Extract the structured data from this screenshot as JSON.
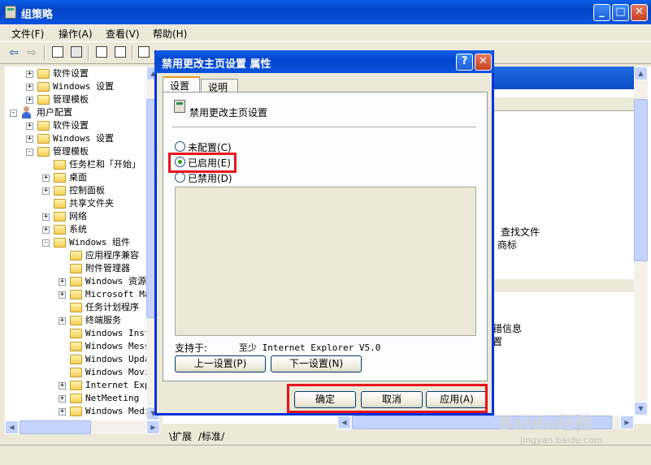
{
  "main_window": {
    "title": "组策略",
    "menu": [
      "文件(F)",
      "操作(A)",
      "查看(V)",
      "帮助(H)"
    ]
  },
  "tree": {
    "items": [
      {
        "label": "软件设置",
        "expander": "+"
      },
      {
        "label": "Windows 设置",
        "expander": "+"
      },
      {
        "label": "管理模板",
        "expander": "+"
      },
      {
        "label": "用户配置",
        "expander": "-"
      },
      {
        "label": "软件设置",
        "expander": "+"
      },
      {
        "label": "Windows 设置",
        "expander": "+"
      },
      {
        "label": "管理模板",
        "expander": "-"
      },
      {
        "label": "任务栏和「开始」",
        "expander": ""
      },
      {
        "label": "桌面",
        "expander": "+"
      },
      {
        "label": "控制面板",
        "expander": "+"
      },
      {
        "label": "共享文件夹",
        "expander": ""
      },
      {
        "label": "网络",
        "expander": "+"
      },
      {
        "label": "系统",
        "expander": "+"
      },
      {
        "label": "Windows 组件",
        "expander": "-"
      },
      {
        "label": "应用程序兼容",
        "expander": ""
      },
      {
        "label": "附件管理器",
        "expander": ""
      },
      {
        "label": "Windows 资源",
        "expander": "+"
      },
      {
        "label": "Microsoft Ma",
        "expander": "+"
      },
      {
        "label": "任务计划程序",
        "expander": ""
      },
      {
        "label": "终端服务",
        "expander": "+"
      },
      {
        "label": "Windows Inst",
        "expander": ""
      },
      {
        "label": "Windows Mess",
        "expander": ""
      },
      {
        "label": "Windows Upda",
        "expander": ""
      },
      {
        "label": "Windows Movi",
        "expander": ""
      },
      {
        "label": "Internet Expl",
        "expander": "+"
      },
      {
        "label": "NetMeeting",
        "expander": "+"
      },
      {
        "label": "Windows Medi",
        "expander": "+"
      }
    ]
  },
  "right_pane": {
    "texts": [
      "查找文件",
      "商标",
      "错信息",
      "置"
    ]
  },
  "view_tabs": [
    "扩展",
    "标准"
  ],
  "dialog": {
    "title": "禁用更改主页设置 属性",
    "help_btn": "?",
    "tabs": [
      "设置",
      "说明"
    ],
    "policy_name": "禁用更改主页设置",
    "options": [
      {
        "label": "未配置(C)",
        "checked": false
      },
      {
        "label": "已启用(E)",
        "checked": true
      },
      {
        "label": "已禁用(D)",
        "checked": false
      }
    ],
    "supported_label": "支持于:",
    "supported_value": "至少 Internet Explorer V5.0",
    "prev_button": "上一设置(P)",
    "next_button": "下一设置(N)",
    "ok_button": "确定",
    "cancel_button": "取消",
    "apply_button": "应用(A)"
  },
  "watermark": {
    "brand": "Baidu经验",
    "url": "jingyan.baidu.com"
  },
  "colors": {
    "highlight": "#e8141c",
    "title_blue": "#0a53e0"
  }
}
